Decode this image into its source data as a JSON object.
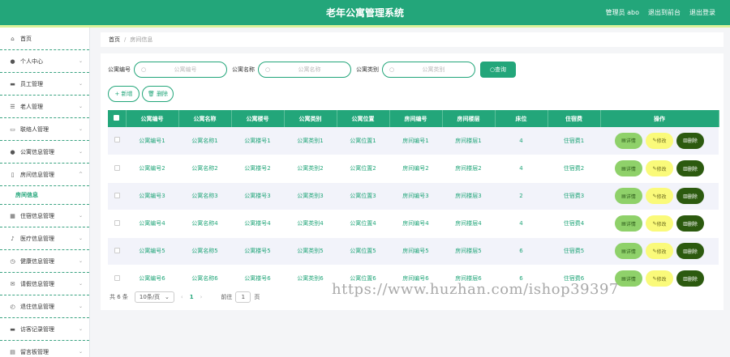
{
  "header": {
    "title": "老年公寓管理系统",
    "user": "管理员 abo",
    "frontend_link": "退出到前台",
    "logout_link": "退出登录"
  },
  "sidebar": {
    "items": [
      {
        "label": "首页",
        "icon": "home-icon",
        "chevron": ""
      },
      {
        "label": "个人中心",
        "icon": "user-icon",
        "chevron": "⌄"
      },
      {
        "label": "员工管理",
        "icon": "staff-icon",
        "chevron": "⌄"
      },
      {
        "label": "老人管理",
        "icon": "list-icon",
        "chevron": "⌄"
      },
      {
        "label": "联络人管理",
        "icon": "contact-card-icon",
        "chevron": "⌄"
      },
      {
        "label": "公寓信息管理",
        "icon": "person-icon",
        "chevron": "⌄"
      },
      {
        "label": "房间信息管理",
        "icon": "phone-icon",
        "chevron": "^"
      }
    ],
    "sub_item": "房间信息",
    "items_after": [
      {
        "label": "住宿信息管理",
        "icon": "grid-icon",
        "chevron": "⌄"
      },
      {
        "label": "医疗信息管理",
        "icon": "mic-icon",
        "chevron": "⌄"
      },
      {
        "label": "健康信息管理",
        "icon": "clock-icon",
        "chevron": "⌄"
      },
      {
        "label": "请假信息管理",
        "icon": "mail-icon",
        "chevron": "⌄"
      },
      {
        "label": "退住信息管理",
        "icon": "history-icon",
        "chevron": "⌄"
      },
      {
        "label": "访客记录管理",
        "icon": "chat-icon",
        "chevron": "⌄"
      },
      {
        "label": "留言板管理",
        "icon": "board-icon",
        "chevron": "⌄"
      }
    ]
  },
  "breadcrumb": {
    "home": "首页",
    "sep": "/",
    "current": "房间信息"
  },
  "search": {
    "fields": [
      {
        "label": "公寓编号",
        "placeholder": "公寓编号"
      },
      {
        "label": "公寓名称",
        "placeholder": "公寓名称"
      },
      {
        "label": "公寓类别",
        "placeholder": "公寓类别"
      }
    ],
    "button": "查询"
  },
  "actions": {
    "add": "+ 新增",
    "delete": "删除"
  },
  "table": {
    "headers": [
      "公寓编号",
      "公寓名称",
      "公寓楼号",
      "公寓类别",
      "公寓位置",
      "房间编号",
      "房间楼层",
      "床位",
      "住宿费",
      "操作"
    ],
    "rows": [
      [
        "公寓编号1",
        "公寓名称1",
        "公寓楼号1",
        "公寓类别1",
        "公寓位置1",
        "房间编号1",
        "房间楼层1",
        "4",
        "住宿费1"
      ],
      [
        "公寓编号2",
        "公寓名称2",
        "公寓楼号2",
        "公寓类别2",
        "公寓位置2",
        "房间编号2",
        "房间楼层2",
        "4",
        "住宿费2"
      ],
      [
        "公寓编号3",
        "公寓名称3",
        "公寓楼号3",
        "公寓类别3",
        "公寓位置3",
        "房间编号3",
        "房间楼层3",
        "2",
        "住宿费3"
      ],
      [
        "公寓编号4",
        "公寓名称4",
        "公寓楼号4",
        "公寓类别4",
        "公寓位置4",
        "房间编号4",
        "房间楼层4",
        "4",
        "住宿费4"
      ],
      [
        "公寓编号5",
        "公寓名称5",
        "公寓楼号5",
        "公寓类别5",
        "公寓位置5",
        "房间编号5",
        "房间楼层5",
        "6",
        "住宿费5"
      ],
      [
        "公寓编号6",
        "公寓名称6",
        "公寓楼号6",
        "公寓类别6",
        "公寓位置6",
        "房间编号6",
        "房间楼层6",
        "6",
        "住宿费6"
      ]
    ],
    "ops": {
      "detail": "详情",
      "edit": "修改",
      "delete": "删除"
    }
  },
  "pager": {
    "total": "共 6 条",
    "page_size": "10条/页",
    "current_page": "1",
    "goto_label": "前往",
    "goto_value": "1",
    "page_unit": "页"
  },
  "watermark": "https://www.huzhan.com/ishop39397",
  "colors": {
    "primary": "#23a67a",
    "accent_bar": "#d9f29a",
    "detail": "#8fd16a",
    "edit": "#fafa7a",
    "delete": "#2c5a0f"
  }
}
